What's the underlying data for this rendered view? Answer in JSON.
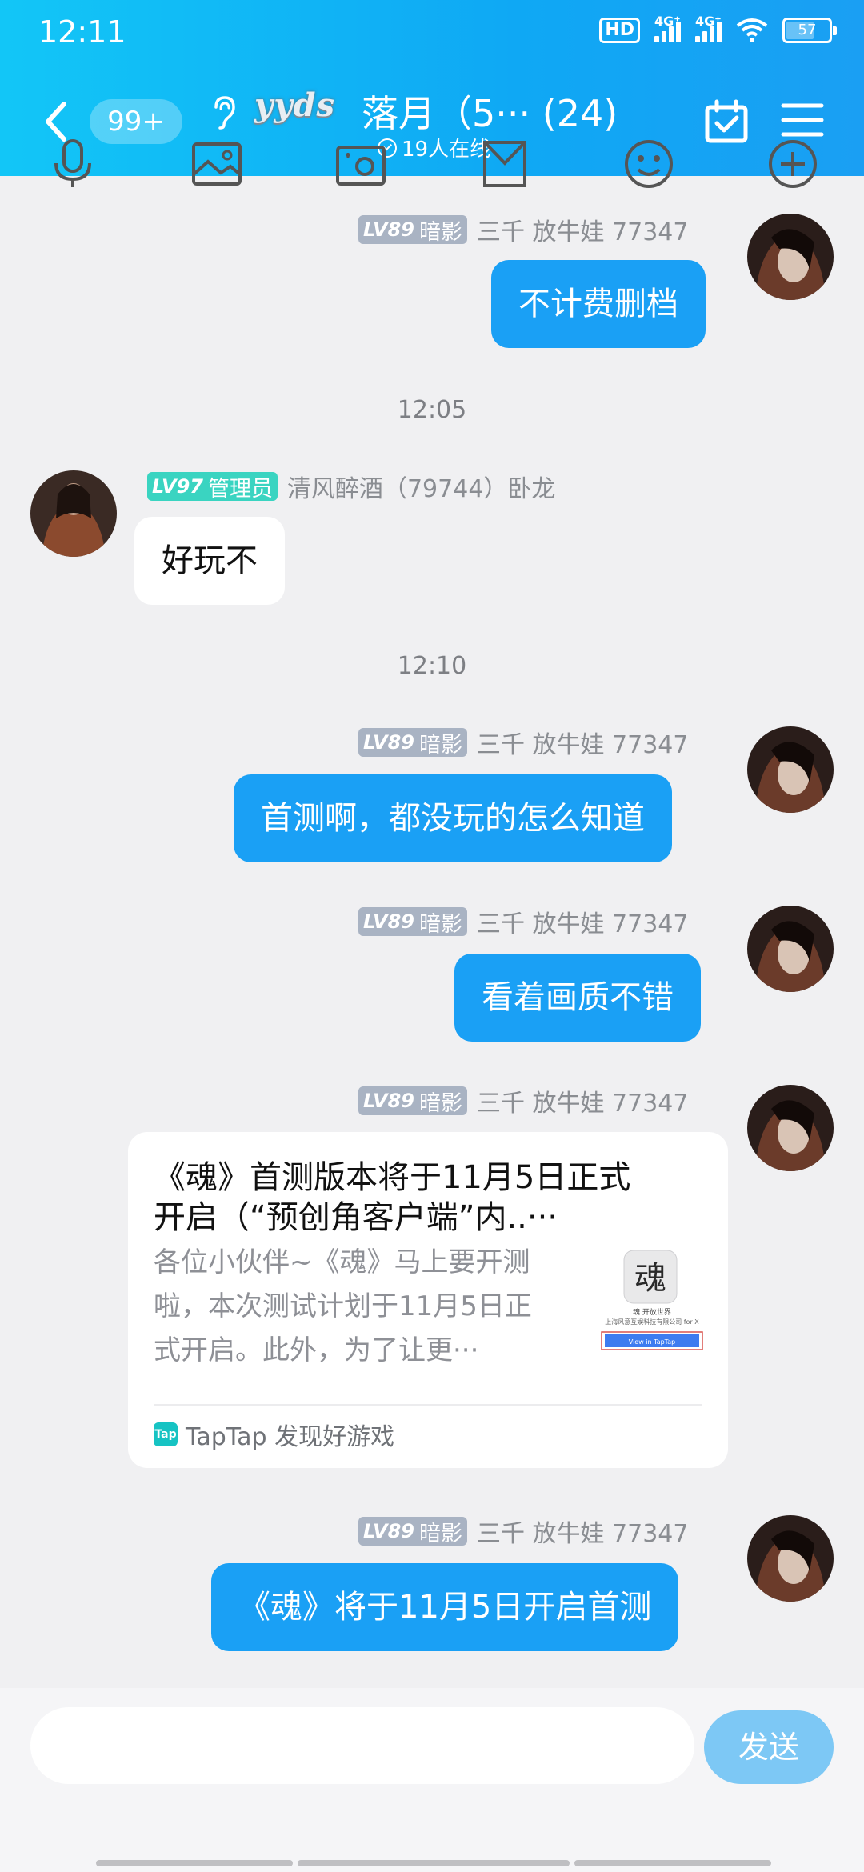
{
  "status_bar": {
    "time": "12:11",
    "hd": "HD",
    "net1": "4G⁺",
    "net2": "4G⁺",
    "battery": "57"
  },
  "header": {
    "unread_count": "99+",
    "logo_text": "yyds",
    "title": "落月（5··· (24)",
    "online_text": "19人在线"
  },
  "messages": [
    {
      "type": "out",
      "level": "LV89",
      "title": "暗影",
      "name": "三千   放牛娃   77347",
      "text": "不计费删档"
    },
    {
      "type": "time",
      "text": "12:05"
    },
    {
      "type": "in",
      "level": "LV97",
      "title": "管理员",
      "name": "清风醉酒（79744）卧龙",
      "text": "好玩不"
    },
    {
      "type": "time",
      "text": "12:10"
    },
    {
      "type": "out",
      "level": "LV89",
      "title": "暗影",
      "name": "三千   放牛娃   77347",
      "text": "首测啊，都没玩的怎么知道"
    },
    {
      "type": "out",
      "level": "LV89",
      "title": "暗影",
      "name": "三千   放牛娃   77347",
      "text": "看着画质不错"
    },
    {
      "type": "card",
      "level": "LV89",
      "title": "暗影",
      "name": "三千   放牛娃   77347",
      "card_title_1": "《魂》首测版本将于11月5日正式",
      "card_title_2": "开启（“预创角客户端”内..···",
      "card_desc_1": "各位小伙伴~《魂》马上要开测",
      "card_desc_2": "啦，本次测试计划于11月5日正",
      "card_desc_3": "式开启。此外，为了让更···",
      "thumb_line_1": "魂 开放世界",
      "thumb_line_2": "上海风意互娱科技有限公司 for X",
      "thumb_button": "View in TapTap",
      "thumb_char": "魂",
      "source_icon": "Tap",
      "source": "TapTap 发现好游戏"
    },
    {
      "type": "out",
      "level": "LV89",
      "title": "暗影",
      "name": "三千   放牛娃   77347",
      "text": "《魂》将于11月5日开启首测"
    }
  ],
  "composer": {
    "placeholder": "",
    "send_label": "发送"
  },
  "toolbar": [
    "mic-icon",
    "image-icon",
    "camera-icon",
    "file-icon",
    "emoji-icon",
    "plus-icon"
  ]
}
